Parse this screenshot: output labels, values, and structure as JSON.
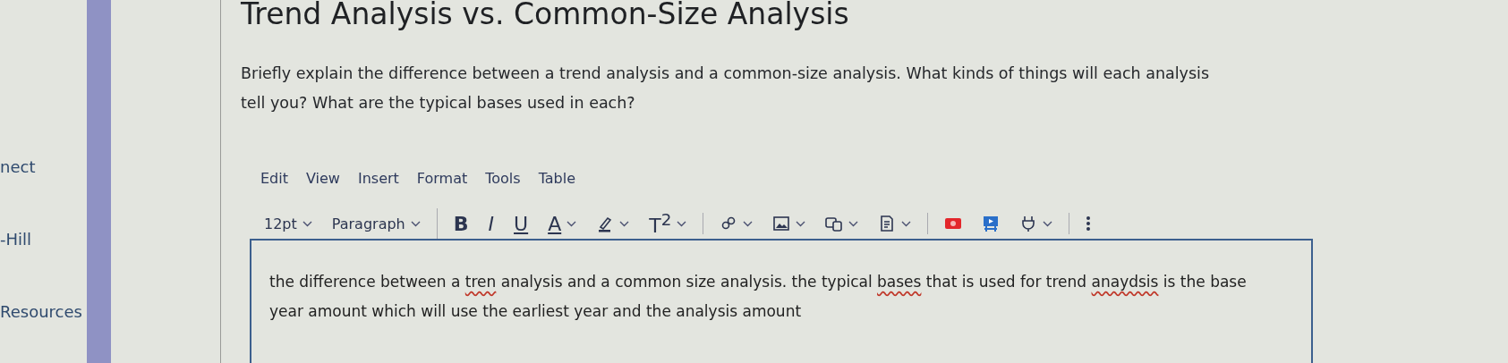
{
  "sidebar": {
    "items": [
      {
        "label": "nect"
      },
      {
        "label": "-Hill"
      },
      {
        "label": "Resources"
      }
    ]
  },
  "question": {
    "title": "Trend Analysis vs. Common-Size Analysis",
    "prompt": "Briefly explain the difference between a trend analysis and a common-size analysis.  What kinds of things will each analysis tell you?  What are the typical bases used in each?"
  },
  "editor": {
    "menu": [
      "Edit",
      "View",
      "Insert",
      "Format",
      "Tools",
      "Table"
    ],
    "toolbar": [
      [
        {
          "kind": "select",
          "label": "12pt"
        },
        {
          "kind": "select",
          "label": "Paragraph"
        }
      ],
      [
        {
          "kind": "bold",
          "label": "B",
          "has_menu": false
        },
        {
          "kind": "italic",
          "label": "I",
          "has_menu": false
        },
        {
          "kind": "underline",
          "label": "U",
          "has_menu": false
        },
        {
          "kind": "color",
          "label": "A",
          "has_menu": true
        },
        {
          "kind": "highlight",
          "has_menu": true
        },
        {
          "kind": "plain",
          "label": "T$^{2}$",
          "has_menu": true
        }
      ],
      [
        {
          "kind": "link",
          "has_menu": true
        },
        {
          "kind": "image",
          "has_menu": true
        },
        {
          "kind": "media",
          "has_menu": true
        },
        {
          "kind": "document",
          "has_menu": true
        }
      ],
      [
        {
          "kind": "record",
          "has_menu": false
        },
        {
          "kind": "video",
          "has_menu": false
        },
        {
          "kind": "plugin",
          "has_menu": true
        }
      ],
      [
        {
          "kind": "more",
          "has_menu": false
        }
      ]
    ],
    "answer": [
      {
        "text": "the difference between a ",
        "misspelled": false
      },
      {
        "text": "tren",
        "misspelled": true
      },
      {
        "text": " analysis and a common size analysis. the typical ",
        "misspelled": false
      },
      {
        "text": "bases",
        "misspelled": true
      },
      {
        "text": " that is used for trend ",
        "misspelled": false
      },
      {
        "text": "anaydsis",
        "misspelled": true
      },
      {
        "text": " is the base year amount which will use the earliest year and the analysis amount",
        "misspelled": false
      }
    ]
  }
}
